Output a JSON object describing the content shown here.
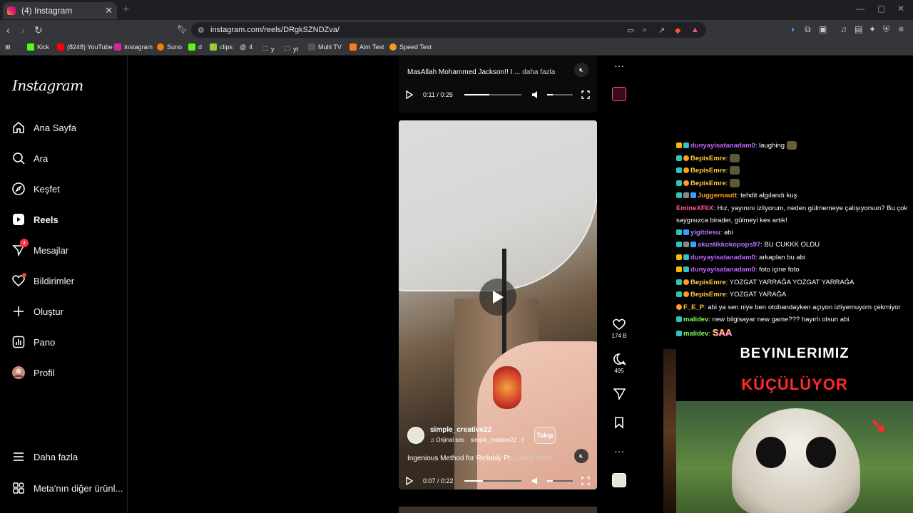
{
  "browser": {
    "tab_title": "(4) Instagram",
    "url": "instagram.com/reels/DRgkSZNDZva/",
    "bookmarks": [
      "Kick",
      "(8248) YouTube",
      "Instagram",
      "Suno",
      "d",
      "clips",
      "4",
      "y",
      "yt",
      "Multi TV",
      "Aim Test",
      "Speed Test"
    ]
  },
  "sidebar": {
    "logo": "Instagram",
    "items": [
      {
        "label": "Ana Sayfa",
        "icon": "home-icon"
      },
      {
        "label": "Ara",
        "icon": "search-icon"
      },
      {
        "label": "Keşfet",
        "icon": "compass-icon"
      },
      {
        "label": "Reels",
        "icon": "reels-icon"
      },
      {
        "label": "Mesajlar",
        "icon": "messenger-icon",
        "badge": "4"
      },
      {
        "label": "Bildirimler",
        "icon": "heart-icon"
      },
      {
        "label": "Oluştur",
        "icon": "plus-icon"
      },
      {
        "label": "Pano",
        "icon": "dashboard-icon"
      },
      {
        "label": "Profil",
        "icon": "avatar"
      },
      {
        "label": "Daha fazla",
        "icon": "menu-icon"
      },
      {
        "label": "Meta'nın diğer ürünl...",
        "icon": "meta-grid-icon"
      }
    ]
  },
  "reel_top": {
    "caption": "MasAllah Mohammed Jackson!! I ...",
    "more": "daha fazla",
    "time": "0:11 / 0:25",
    "progress": 0.44
  },
  "reel_main": {
    "author": "simple_creative22",
    "audio_label": "Orijinal ses",
    "audio_author": "simple_creative22 · (",
    "follow_label": "Takip",
    "caption": "Ingenious Method for Reliably Pr...",
    "more": "daha fazla",
    "time": "0:07 / 0:22",
    "progress": 0.32,
    "likes": "174 B",
    "comments": "495"
  },
  "chat": [
    {
      "user": "dunyayisatanadam0",
      "color": "#c264ff",
      "text": "laughing",
      "emote": true
    },
    {
      "user": "BepisEmre",
      "color": "#ffc83d",
      "text": "",
      "emote": true
    },
    {
      "user": "BepisEmre",
      "color": "#ffc83d",
      "text": "",
      "emote": true
    },
    {
      "user": "BepisEmre",
      "color": "#ffc83d",
      "text": "",
      "emote": true
    },
    {
      "user": "Juggernautt",
      "color": "#ff9c2a",
      "text": "tehdit algılandı kuş"
    },
    {
      "user": "EmineXFliX",
      "color": "#ff5ca8",
      "text": "Hız, yayınını izliyorum, neden gülmemeye çalışıyorsun? Bu çok saygısızca birader, gülmeyi kes artık!",
      "wrap": true
    },
    {
      "user": "yigitdesu",
      "color": "#b077ff",
      "text": "abi"
    },
    {
      "user": "akustikkokopops97",
      "color": "#b077ff",
      "text": "BU CUKKK OLDU"
    },
    {
      "user": "dunyayisatanadam0",
      "color": "#c264ff",
      "text": "arkaplan bu abi"
    },
    {
      "user": "dunyayisatanadam0",
      "color": "#c264ff",
      "text": "foto içine foto"
    },
    {
      "user": "BepisEmre",
      "color": "#ffc83d",
      "text": "YOZGAT YARRAĞA YOZGAT YARRAĞA"
    },
    {
      "user": "BepisEmre",
      "color": "#ffc83d",
      "text": "YOZGAT YARAĞA"
    },
    {
      "user": "F_E_P",
      "color": "#ffc83d",
      "text": "abi ya sen niye ben otobandayken açıyon izliyemuyom çekmiyor"
    },
    {
      "user": "malidev",
      "color": "#7cff5a",
      "text": "new bilgisayar new game??? hayırlı olsun abi"
    },
    {
      "user": "malidev",
      "color": "#7cff5a",
      "text": "SAA"
    }
  ],
  "thumb": {
    "line1": "BEYINLERIMIZ",
    "line2": "KÜÇÜLÜYOR"
  },
  "colors": {
    "accent": "#ff3040",
    "chat_username_purple": "#c264ff",
    "chat_username_yellow": "#ffc83d",
    "chat_username_green": "#7cff5a"
  }
}
